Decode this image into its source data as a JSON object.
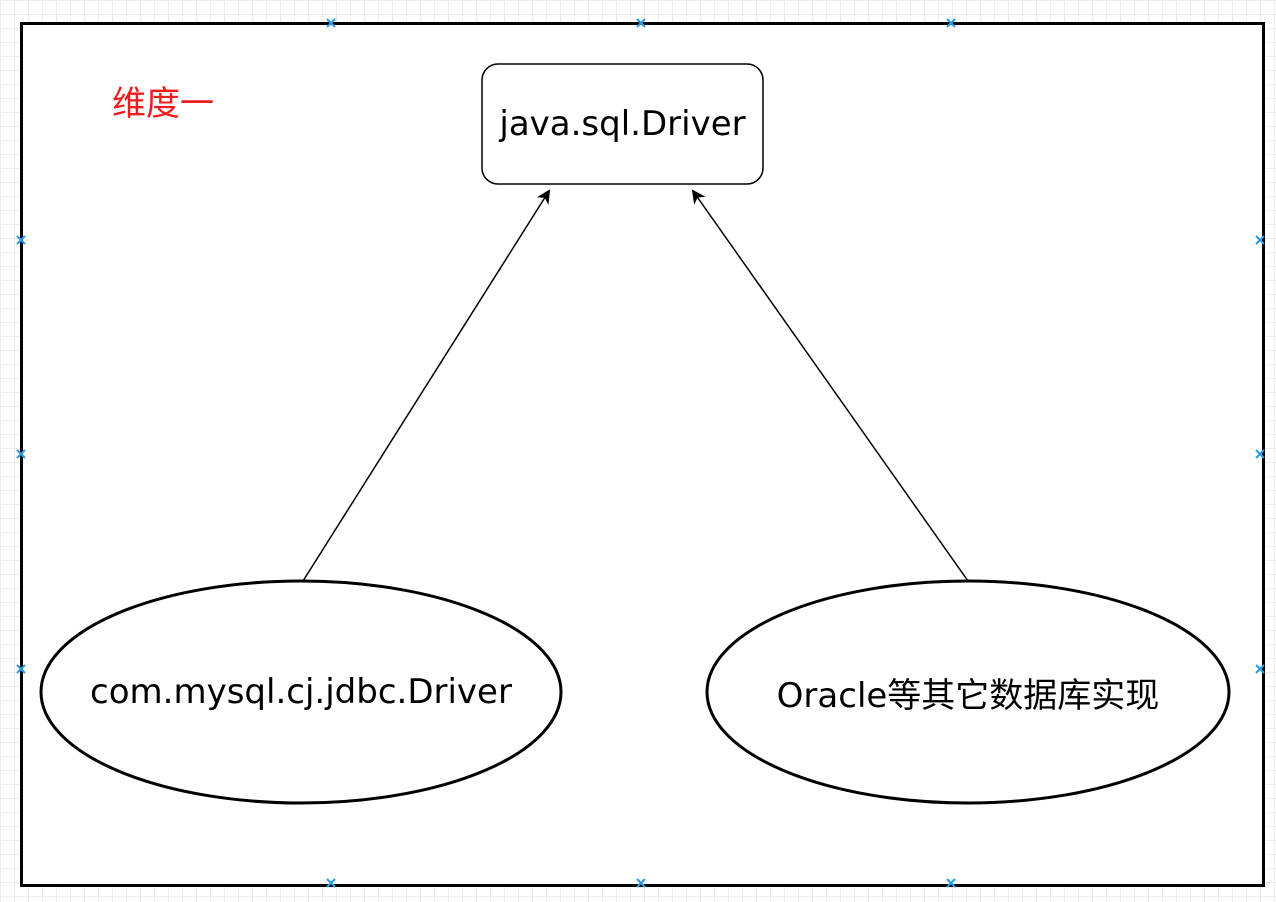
{
  "diagram": {
    "dimension_label": "维度一",
    "dimension_color": "#ee1c1c",
    "nodes": {
      "interface": {
        "label": "java.sql.Driver",
        "shape": "rounded-rectangle"
      },
      "mysql": {
        "label": "com.mysql.cj.jdbc.Driver",
        "shape": "ellipse"
      },
      "oracle": {
        "label": "Oracle等其它数据库实现",
        "shape": "ellipse"
      }
    },
    "edges": [
      {
        "from": "mysql",
        "to": "interface",
        "style": "arrow"
      },
      {
        "from": "oracle",
        "to": "interface",
        "style": "arrow"
      }
    ],
    "selection_handle_color": "#2b9be4"
  }
}
